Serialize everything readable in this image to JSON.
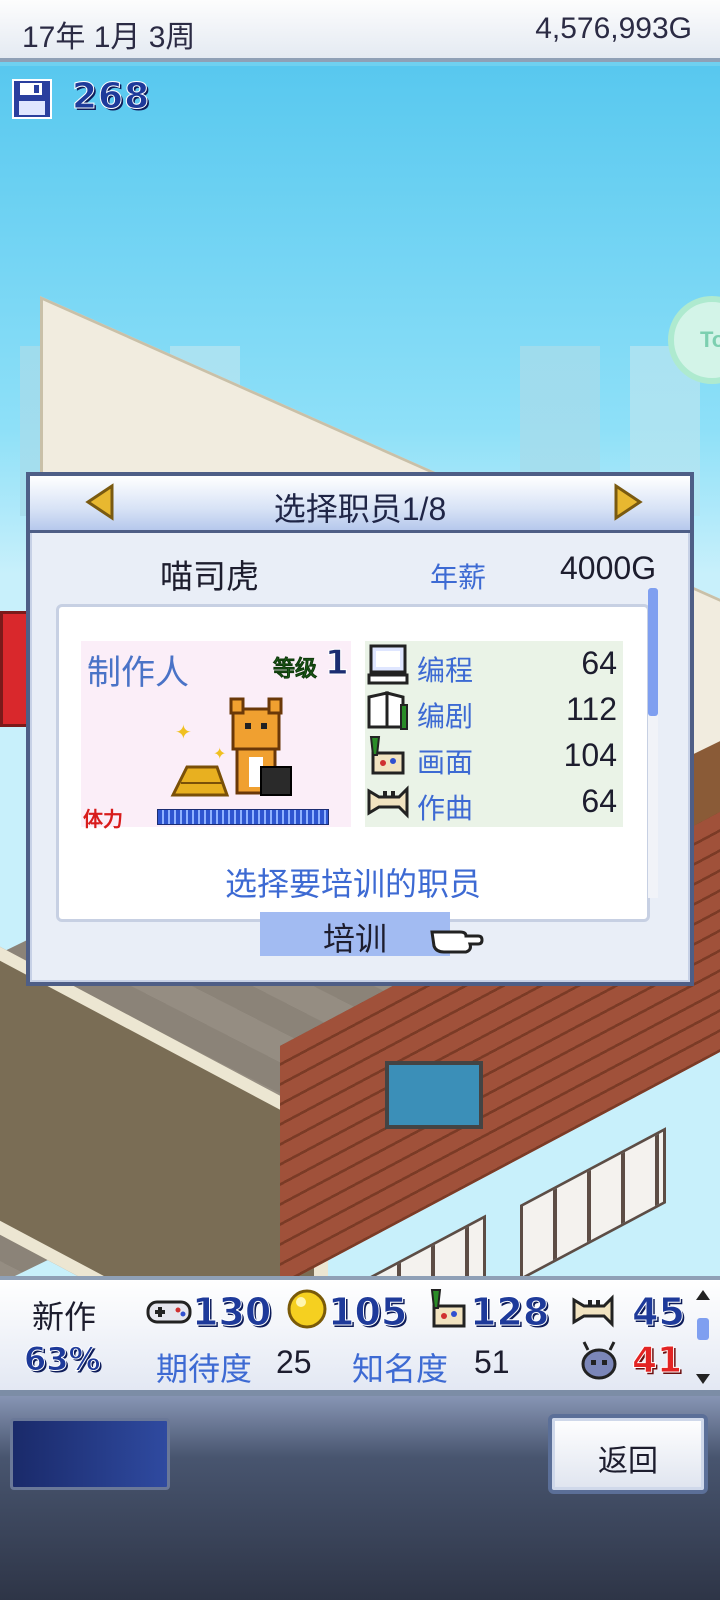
{
  "header": {
    "date": "17年 1月 3周",
    "money": "4,576,993G",
    "disks": "268"
  },
  "dialog": {
    "title": "选择职员1/8",
    "staff_name": "喵司虎",
    "salary_label": "年薪",
    "salary_value": "4000G",
    "role": "制作人",
    "level_label": "等级",
    "level_value": "1",
    "stamina_label": "体力",
    "stamina_fraction": 1.0,
    "stats": [
      {
        "icon": "computer-icon",
        "label": "编程",
        "value": "64"
      },
      {
        "icon": "book-icon",
        "label": "编剧",
        "value": "112"
      },
      {
        "icon": "paint-icon",
        "label": "画面",
        "value": "104"
      },
      {
        "icon": "trumpet-icon",
        "label": "作曲",
        "value": "64"
      }
    ],
    "hint": "选择要培训的职员",
    "train_button": "培训"
  },
  "status": {
    "new_label": "新作",
    "progress_pct": "63%",
    "fun": "130",
    "creativity": "105",
    "graphics": "128",
    "sound": "45",
    "expectation_label": "期待度",
    "expectation_value": "25",
    "fame_label": "知名度",
    "fame_value": "51",
    "bugs": "41"
  },
  "side_button": "To",
  "toolbar": {
    "back_button": "返回"
  }
}
